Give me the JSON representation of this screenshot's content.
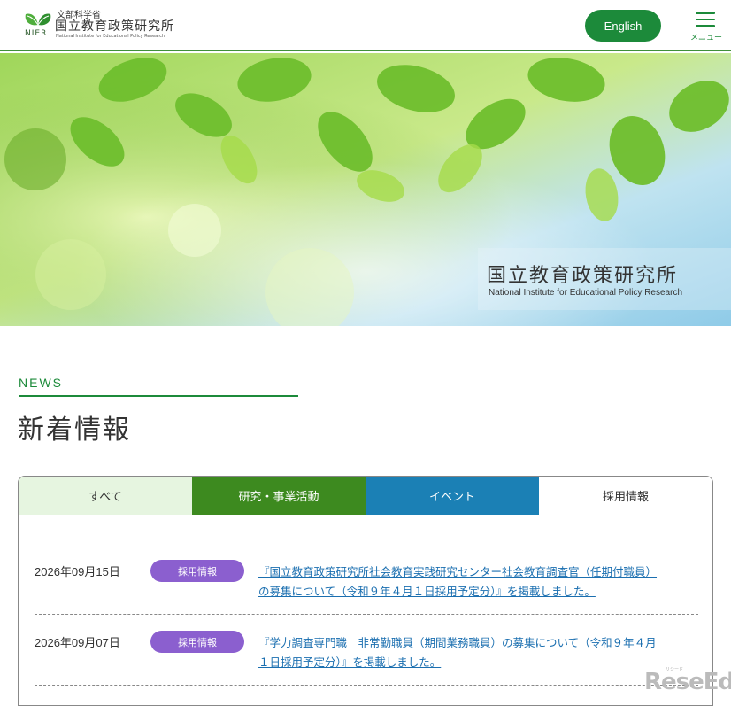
{
  "header": {
    "logo": {
      "mark_text": "NIER",
      "ministry": "文部科学省",
      "name": "国立教育政策研究所",
      "name_en": "National Institute for Educational Policy Research"
    },
    "english_label": "English",
    "menu_label": "メニュー"
  },
  "hero": {
    "title": "国立教育政策研究所",
    "subtitle": "National Institute for Educational Policy Research"
  },
  "news": {
    "label": "NEWS",
    "title": "新着情報",
    "tabs": [
      {
        "label": "すべて"
      },
      {
        "label": "研究・事業活動"
      },
      {
        "label": "イベント"
      },
      {
        "label": "採用情報"
      }
    ],
    "items": [
      {
        "date": "2026年09月15日",
        "badge": "採用情報",
        "line1": "『国立教育政策研究所社会教育実践研究センター社会教育調査官（任期付職員）",
        "line2": "の募集について（令和９年４月１日採用予定分）』を掲載しました。"
      },
      {
        "date": "2026年09月07日",
        "badge": "採用情報",
        "line1": "『学力調査専門職　非常勤職員（期間業務職員）の募集について（令和９年４月",
        "line2": "１日採用予定分）』を掲載しました。"
      }
    ]
  },
  "watermark": {
    "text": "ReseEd",
    "small": "リシード"
  },
  "colors": {
    "brand_green": "#1c8a3a",
    "research_tab": "#3d8a1f",
    "event_tab": "#1b80b5",
    "badge_purple": "#8b5fcf",
    "link_blue": "#1b6fb0"
  }
}
